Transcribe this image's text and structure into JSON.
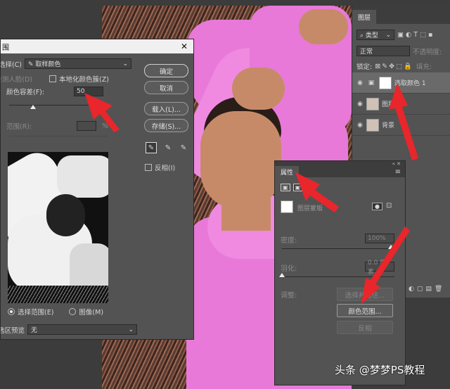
{
  "dialog": {
    "title_fragment": "围",
    "select_label": "选择(C):",
    "select_value": "取样颜色",
    "detect_faces_label": "检测人脸(D)",
    "localized_label": "本地化颜色簇(Z)",
    "fuzziness_label": "颜色容差(F):",
    "fuzziness_value": "50",
    "range_label": "范围(R):",
    "range_unit": "%",
    "ok_label": "确定",
    "cancel_label": "取消",
    "load_label": "载入(L)...",
    "save_label": "存储(S)...",
    "invert_label": "反相(I)",
    "radio_selection_label": "选择范围(E)",
    "radio_image_label": "图像(M)",
    "preview_label": "选区预览:",
    "preview_value": "无"
  },
  "layers": {
    "tab_label": "图层",
    "search_placeholder": "类型",
    "blend_mode": "正常",
    "opacity_label": "不透明度:",
    "lock_label": "锁定:",
    "fill_label": "填充:",
    "rows": [
      {
        "name": "选取颜色 1"
      },
      {
        "name": "图层"
      },
      {
        "name": "背景"
      }
    ]
  },
  "properties": {
    "tab_label": "属性",
    "mask_label": "图层蒙版",
    "density_label": "密度:",
    "density_value": "100%",
    "feather_label": "羽化:",
    "feather_value": "0.0 像素",
    "adjust_label": "调整:",
    "select_subject_label": "选择并遮住...",
    "color_range_label": "颜色范围...",
    "invert_label": "反相"
  },
  "watermark": "头条 @梦梦PS教程",
  "colors": {
    "arrow": "#e8262b",
    "shirt": "#e879d8",
    "panel": "#535353"
  }
}
